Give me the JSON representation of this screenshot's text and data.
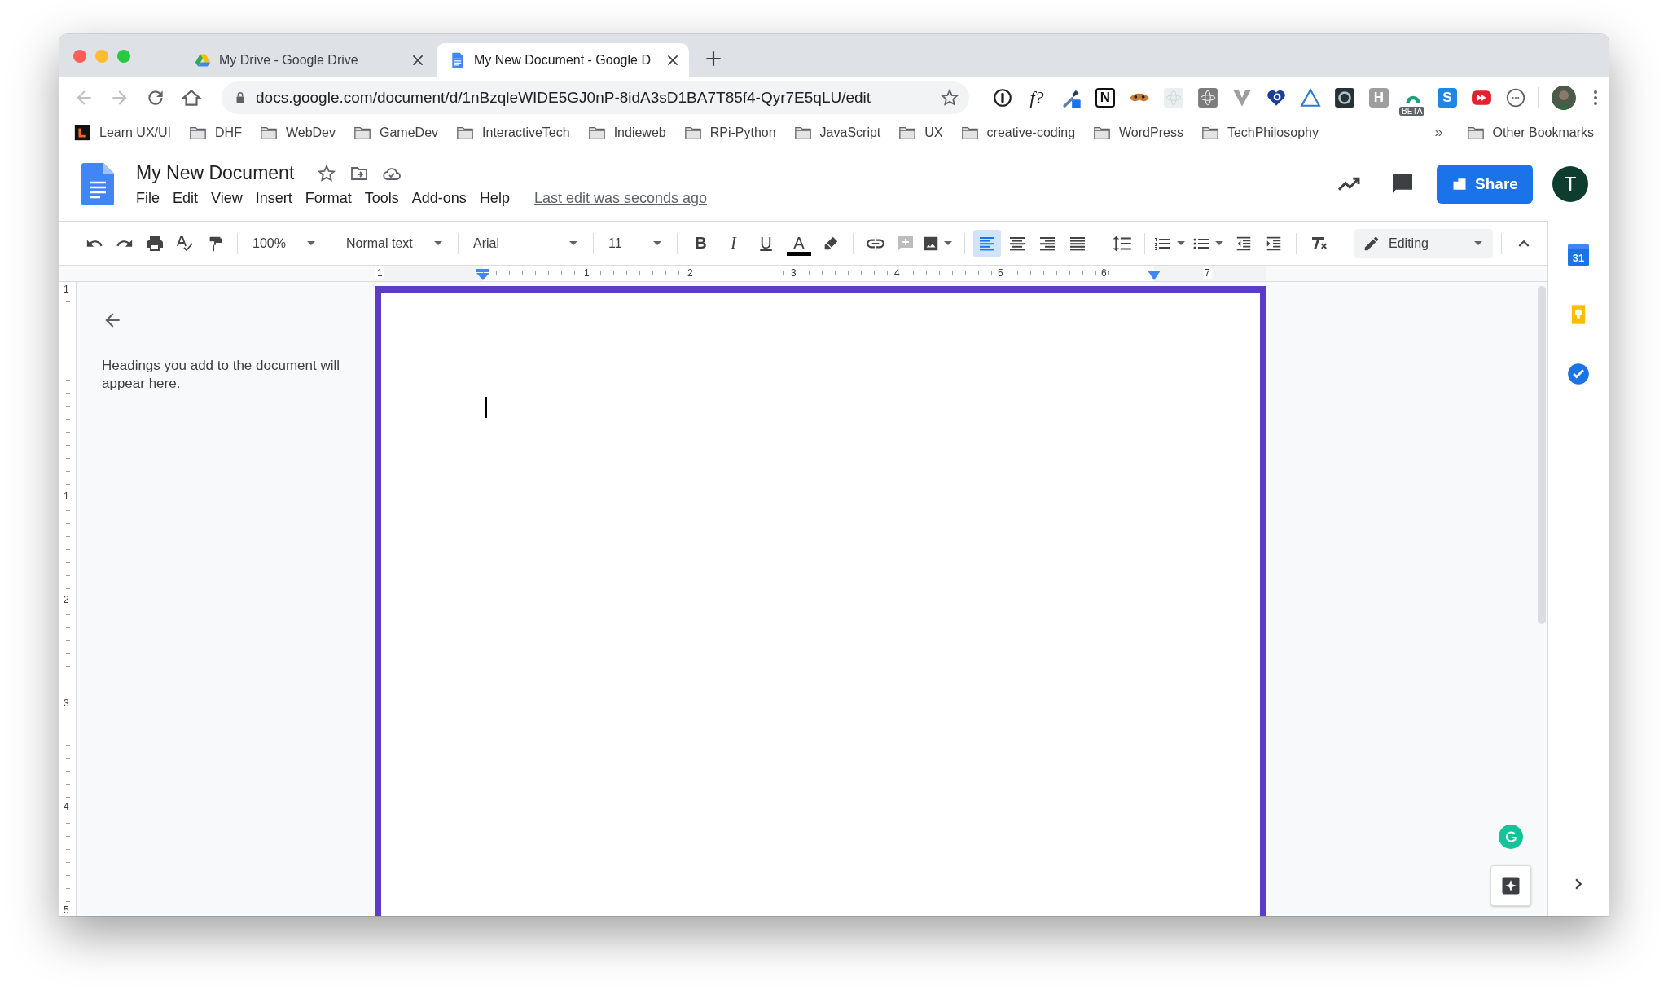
{
  "browser_tabs": [
    {
      "title": "My Drive - Google Drive",
      "kind": "drive",
      "selected": false
    },
    {
      "title": "My New Document - Google D",
      "kind": "docs",
      "selected": true
    }
  ],
  "address_bar": {
    "url": "docs.google.com/document/d/1nBzqleWIDE5GJ0nP-8idA3sD1BA7T85f4-Qyr7E5qLU/edit"
  },
  "extensions": [
    {
      "kind": "info"
    },
    {
      "kind": "glyph",
      "text": "f?"
    },
    {
      "kind": "dropper"
    },
    {
      "kind": "letter",
      "text": "N",
      "color": "#ffffff"
    },
    {
      "kind": "mask"
    },
    {
      "kind": "atom-light"
    },
    {
      "kind": "atom-dark"
    },
    {
      "kind": "chevron"
    },
    {
      "kind": "heart"
    },
    {
      "kind": "triangle"
    },
    {
      "kind": "eye"
    },
    {
      "kind": "letter",
      "text": "H",
      "color": "#9e9e9e"
    },
    {
      "kind": "dome",
      "badge": "BETA"
    },
    {
      "kind": "letter",
      "text": "S",
      "color": "#1e88e5"
    },
    {
      "kind": "play"
    },
    {
      "kind": "braces"
    }
  ],
  "bookmarks": [
    {
      "label": "Learn UX/UI",
      "kind": "app"
    },
    {
      "label": "DHF",
      "kind": "folder"
    },
    {
      "label": "WebDev",
      "kind": "folder"
    },
    {
      "label": "GameDev",
      "kind": "folder"
    },
    {
      "label": "InteractiveTech",
      "kind": "folder"
    },
    {
      "label": "Indieweb",
      "kind": "folder"
    },
    {
      "label": "RPi-Python",
      "kind": "folder"
    },
    {
      "label": "JavaScript",
      "kind": "folder"
    },
    {
      "label": "UX",
      "kind": "folder"
    },
    {
      "label": "creative-coding",
      "kind": "folder"
    },
    {
      "label": "WordPress",
      "kind": "folder"
    },
    {
      "label": "TechPhilosophy",
      "kind": "folder"
    }
  ],
  "bookmarks_overflow": "»",
  "other_bookmarks": "Other Bookmarks",
  "document": {
    "title": "My New Document",
    "menu": [
      "File",
      "Edit",
      "View",
      "Insert",
      "Format",
      "Tools",
      "Add-ons",
      "Help"
    ],
    "last_edit": "Last edit was seconds ago"
  },
  "share": "Share",
  "avatar": "T",
  "toolbar": {
    "zoom": "100%",
    "style": "Normal text",
    "font": "Arial",
    "size": "11",
    "format": [
      {
        "label": "B",
        "kind": "bold"
      },
      {
        "label": "I",
        "kind": "italic"
      },
      {
        "label": "U",
        "kind": "underline"
      },
      {
        "label": "A",
        "kind": "color"
      }
    ],
    "align": [
      {
        "kind": "left",
        "selected": true
      },
      {
        "kind": "center",
        "selected": false
      },
      {
        "kind": "right",
        "selected": false
      },
      {
        "kind": "justify",
        "selected": false
      }
    ],
    "mode": "Editing"
  },
  "ruler": {
    "horizontal": [
      "1",
      "1",
      "2",
      "3",
      "4",
      "5",
      "6",
      "7"
    ],
    "vertical": [
      "1",
      "1",
      "2",
      "3",
      "4",
      "5"
    ]
  },
  "outline": {
    "hint": "Headings you add to the document will appear here."
  },
  "side_panel": [
    {
      "kind": "calendar",
      "label": "31"
    },
    {
      "kind": "keep"
    },
    {
      "kind": "tasks"
    }
  ]
}
